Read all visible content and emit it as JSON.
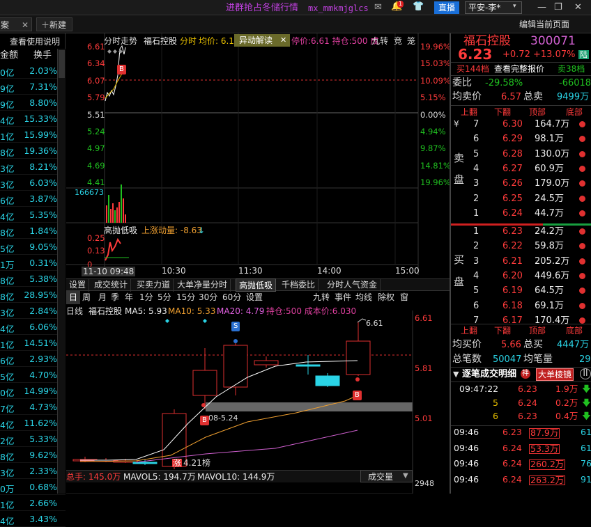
{
  "topbar": {
    "promo": "进群抢占冬储行情",
    "promo_code": "mx_mmkmjglcs",
    "notif_count": "1",
    "live_label": "直播",
    "broker": "平安-李*",
    "win_min": "—",
    "win_max": "❐",
    "win_close": "✕"
  },
  "tabrow": {
    "tab_left": "案",
    "new_tab": "新建",
    "edit_page": "编辑当前页面"
  },
  "leftlist": {
    "help": "查看使用说明",
    "col_amount": "金额",
    "col_turnover": "换手",
    "rows": [
      {
        "a": "0亿",
        "b": "2.03%"
      },
      {
        "a": "9亿",
        "b": "7.31%"
      },
      {
        "a": "9亿",
        "b": "8.80%"
      },
      {
        "a": "4亿",
        "b": "15.33%"
      },
      {
        "a": "1亿",
        "b": "15.99%"
      },
      {
        "a": "8亿",
        "b": "19.36%"
      },
      {
        "a": "3亿",
        "b": "8.21%"
      },
      {
        "a": "3亿",
        "b": "6.03%"
      },
      {
        "a": "6亿",
        "b": "3.87%"
      },
      {
        "a": "4亿",
        "b": "5.35%"
      },
      {
        "a": "8亿",
        "b": "1.84%"
      },
      {
        "a": "5亿",
        "b": "9.05%"
      },
      {
        "a": "1万",
        "b": "0.31%"
      },
      {
        "a": "8亿",
        "b": "5.38%"
      },
      {
        "a": "8亿",
        "b": "28.95%"
      },
      {
        "a": "3亿",
        "b": "2.84%"
      },
      {
        "a": "4亿",
        "b": "6.06%"
      },
      {
        "a": "1亿",
        "b": "14.51%"
      },
      {
        "a": "6亿",
        "b": "2.93%"
      },
      {
        "a": "5亿",
        "b": "4.70%"
      },
      {
        "a": "0亿",
        "b": "14.99%"
      },
      {
        "a": "7亿",
        "b": "4.73%"
      },
      {
        "a": "4亿",
        "b": "11.62%"
      },
      {
        "a": "2亿",
        "b": "5.33%"
      },
      {
        "a": "8亿",
        "b": "9.62%"
      },
      {
        "a": "3亿",
        "b": "2.33%"
      },
      {
        "a": "0万",
        "b": "0.68%"
      },
      {
        "a": "1亿",
        "b": "2.66%"
      },
      {
        "a": "4亿",
        "b": "3.43%"
      }
    ]
  },
  "intraday": {
    "title": "分时走势",
    "stock": "福石控股",
    "label_fenshi": "分时",
    "avg_label": "均价: 6.1",
    "yidong": "异动解读",
    "close_x": "✕",
    "tail": "停价:6.61 持仓:500 成",
    "jiuzhuan": "九转",
    "jing": "竞",
    "long": "笼",
    "left_ticks": [
      "6.61",
      "6.34",
      "6.07",
      "5.79",
      "5.51",
      "5.24",
      "4.97",
      "4.69",
      "4.41"
    ],
    "right_ticks": [
      "19.96%",
      "15.03%",
      "10.09%",
      "5.15%",
      "0.00%",
      "4.94%",
      "9.87%",
      "14.81%",
      "19.96%"
    ],
    "vol_label": "166673",
    "ind_title": "高抛低吸",
    "ind_name": "上涨动量: -8.63",
    "ind_ticks": [
      "0.25",
      "0.13",
      "0"
    ],
    "time_ticks": [
      "11-10 09:48",
      "10:30",
      "11:30",
      "14:00",
      "15:00"
    ],
    "b_marker": "B"
  },
  "ind_tabs": [
    "设置",
    "成交统计",
    "买卖力道",
    "大单净量分时",
    "高抛低吸",
    "千档委比",
    "分时人气资金"
  ],
  "kline": {
    "periods": [
      "日",
      "周",
      "月",
      "季",
      "年",
      "1分",
      "5分",
      "15分",
      "30分",
      "60分",
      "设置"
    ],
    "right_btns": [
      "九转",
      "事件",
      "均线",
      "除权",
      "窗"
    ],
    "title": "日线",
    "stock": "福石控股",
    "ma5": "MA5: 5.93",
    "ma10": "MA10: 5.33",
    "ma20": "MA20: 4.79",
    "hold": "持仓:500 成本价:6.030",
    "ticks": [
      "6.61",
      "5.81",
      "5.01"
    ],
    "high_label": "6.61",
    "low_label": "4.21",
    "zhang": "涨",
    "bang": "榜",
    "date_label": "08-5.24",
    "s_marker": "S",
    "b_marker": "B",
    "vol_total": "总手: 145.0万",
    "vol_ma5": "MAVOL5: 194.7万",
    "vol_ma10": "MAVOL10: 144.9万",
    "vol_select": "成交量",
    "vol_num": "2948"
  },
  "quote": {
    "name": "福石控股",
    "code": "300071",
    "price": "6.23",
    "change": "+0.72",
    "pct": "+13.07%",
    "badge": "陆",
    "sell_tier": "买144档",
    "full_quote": "查看完整报价",
    "buy_tier": "卖38档",
    "weibi_label": "委比",
    "weibi": "-29.58%",
    "weicha": "-66018",
    "avg_sell_label": "均卖价",
    "avg_sell": "6.57",
    "total_sell_label": "总卖",
    "total_sell": "9499万",
    "hdr": [
      "上翻",
      "下翻",
      "顶部",
      "底部"
    ],
    "sell_side_label": [
      "卖",
      "盘"
    ],
    "yen": "¥",
    "asks": [
      {
        "n": "7",
        "p": "6.30",
        "v": "164.7万"
      },
      {
        "n": "6",
        "p": "6.29",
        "v": "98.1万"
      },
      {
        "n": "5",
        "p": "6.28",
        "v": "130.0万"
      },
      {
        "n": "4",
        "p": "6.27",
        "v": "60.9万"
      },
      {
        "n": "3",
        "p": "6.26",
        "v": "179.0万"
      },
      {
        "n": "2",
        "p": "6.25",
        "v": "24.5万"
      },
      {
        "n": "1",
        "p": "6.24",
        "v": "44.7万"
      }
    ],
    "buy_side_label": [
      "买",
      "盘"
    ],
    "bids": [
      {
        "n": "1",
        "p": "6.23",
        "v": "24.2万"
      },
      {
        "n": "2",
        "p": "6.22",
        "v": "59.8万"
      },
      {
        "n": "3",
        "p": "6.21",
        "v": "205.2万"
      },
      {
        "n": "4",
        "p": "6.20",
        "v": "449.6万"
      },
      {
        "n": "5",
        "p": "6.19",
        "v": "64.5万"
      },
      {
        "n": "6",
        "p": "6.18",
        "v": "69.1万"
      },
      {
        "n": "7",
        "p": "6.17",
        "v": "170.4万"
      }
    ],
    "avg_buy_label": "均买价",
    "avg_buy": "5.66",
    "total_buy_label": "总买",
    "total_buy": "4447万",
    "total_deals_label": "总笔数",
    "total_deals": "50047",
    "avg_vol_label": "均笔量",
    "avg_vol": "29",
    "detail_title": "逐笔成交明细",
    "detail_badge": "袢",
    "big_order": "大单棱镜",
    "trades_a": [
      {
        "t": "09:47:22",
        "p": "6.23",
        "v": "1.9万",
        "d": "down"
      },
      {
        "t": "5",
        "p": "6.24",
        "v": "0.2万",
        "d": "down"
      },
      {
        "t": "6",
        "p": "6.23",
        "v": "0.4万",
        "d": "down"
      }
    ],
    "trades_b": [
      {
        "t": "09:46",
        "p": "6.23",
        "v": "87.9万",
        "c": "61"
      },
      {
        "t": "09:46",
        "p": "6.24",
        "v": "53.3万",
        "c": "61"
      },
      {
        "t": "09:46",
        "p": "6.24",
        "v": "260.2万",
        "c": "76"
      },
      {
        "t": "09:46",
        "p": "6.24",
        "v": "263.2万",
        "c": "91"
      }
    ]
  },
  "colors": {
    "up": "#ff3b3b",
    "down": "#20c020",
    "cyan": "#2ad4e6",
    "yellow": "#e8c000"
  }
}
